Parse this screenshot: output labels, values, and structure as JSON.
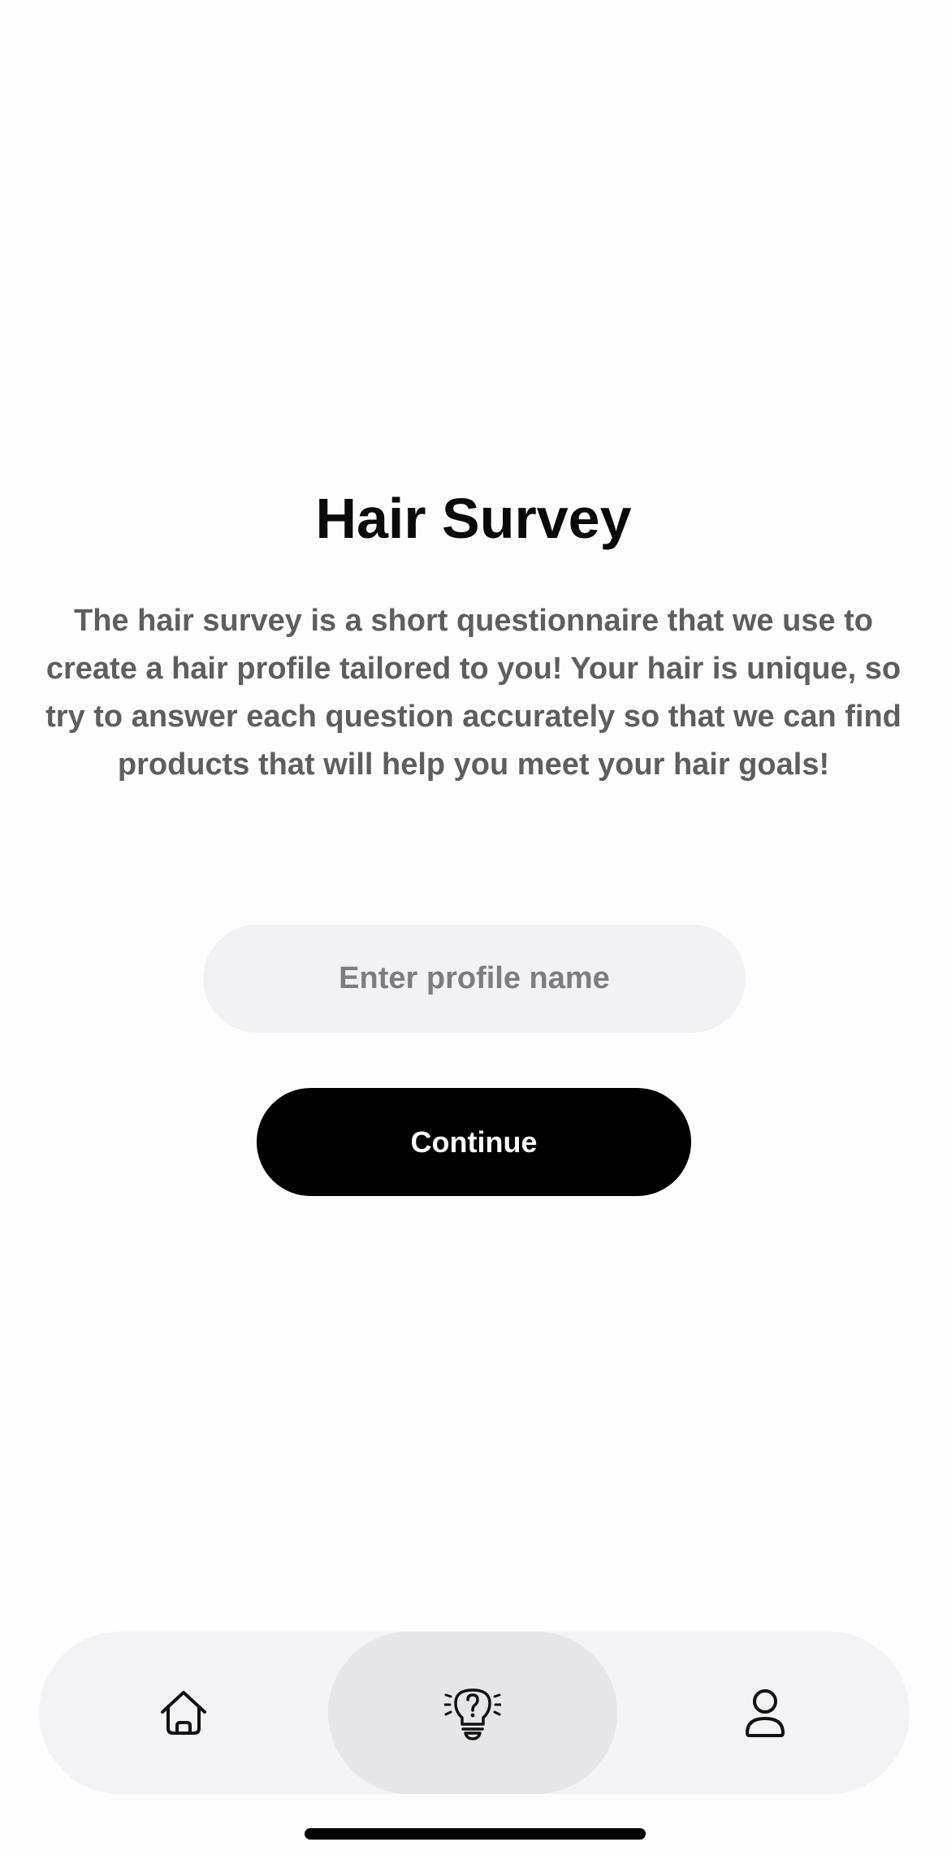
{
  "page": {
    "title": "Hair Survey",
    "description": "The hair survey is a short questionnaire that we use to create a hair profile tailored to you! Your hair is unique, so try to answer each question accurately so that we can find products that will help you meet your hair goals!"
  },
  "profile_input": {
    "placeholder": "Enter profile name",
    "value": ""
  },
  "continue_button": {
    "label": "Continue"
  },
  "tab_bar": {
    "selected": "survey",
    "tabs": [
      {
        "id": "home",
        "icon": "home-icon"
      },
      {
        "id": "survey",
        "icon": "lightbulb-question-icon"
      },
      {
        "id": "profile",
        "icon": "person-icon"
      }
    ]
  },
  "colors": {
    "background": "#fefdfe",
    "primary_button": "#000000",
    "input_background": "#f2f1f4",
    "tab_bar_background": "#f3f2f5",
    "selected_tab_background": "#e6e5e8",
    "body_text": "#5e5e60"
  }
}
